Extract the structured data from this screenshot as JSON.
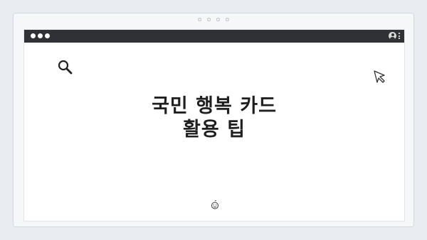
{
  "headline": {
    "line1": "국민 행복 카드",
    "line2": "활용 팁"
  },
  "icons": {
    "search": "search-icon",
    "cursor": "cursor-icon",
    "user": "user-icon",
    "menu": "kebab-menu-icon",
    "mascot": "smiley-face-icon"
  },
  "colors": {
    "titlebar": "#2f3135",
    "background": "#e9edf1",
    "text": "#1f1f1f"
  }
}
